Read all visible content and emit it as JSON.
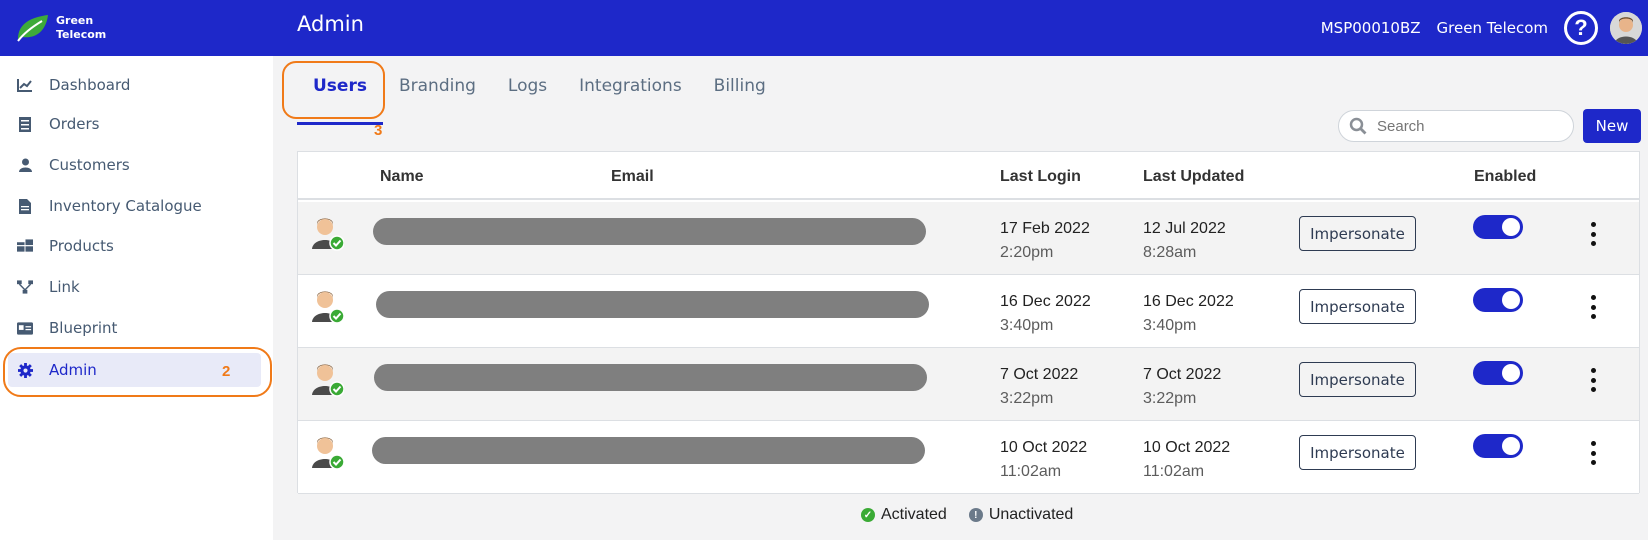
{
  "brand": {
    "name_line1": "Green",
    "name_line2": "Telecom",
    "color": "#3eaa3a"
  },
  "header": {
    "title": "Admin",
    "account_id": "MSP00010BZ",
    "account_name": "Green Telecom",
    "bg": "#1e28c9"
  },
  "sidebar": {
    "items": [
      {
        "label": "Dashboard",
        "icon": "chart-line-icon"
      },
      {
        "label": "Orders",
        "icon": "receipt-icon"
      },
      {
        "label": "Customers",
        "icon": "person-icon"
      },
      {
        "label": "Inventory Catalogue",
        "icon": "document-icon"
      },
      {
        "label": "Products",
        "icon": "boxes-icon"
      },
      {
        "label": "Link",
        "icon": "network-icon"
      },
      {
        "label": "Blueprint",
        "icon": "id-card-icon"
      },
      {
        "label": "Admin",
        "icon": "gear-icon",
        "active": true
      }
    ],
    "annotation": "2"
  },
  "tabs": {
    "items": [
      "Users",
      "Branding",
      "Logs",
      "Integrations",
      "Billing"
    ],
    "active": "Users",
    "annotation": "3"
  },
  "toolbar": {
    "search_placeholder": "Search",
    "new_label": "New"
  },
  "table": {
    "headers": {
      "name": "Name",
      "email": "Email",
      "last_login": "Last Login",
      "last_updated": "Last Updated",
      "enabled": "Enabled"
    },
    "rows": [
      {
        "login_date": "17 Feb 2022",
        "login_time": "2:20pm",
        "updated_date": "12 Jul 2022",
        "updated_time": "8:28am",
        "action": "Impersonate",
        "enabled": true
      },
      {
        "login_date": "16 Dec 2022",
        "login_time": "3:40pm",
        "updated_date": "16 Dec 2022",
        "updated_time": "3:40pm",
        "action": "Impersonate",
        "enabled": true
      },
      {
        "login_date": "7 Oct 2022",
        "login_time": "3:22pm",
        "updated_date": "7 Oct 2022",
        "updated_time": "3:22pm",
        "action": "Impersonate",
        "enabled": true
      },
      {
        "login_date": "10 Oct 2022",
        "login_time": "11:02am",
        "updated_date": "10 Oct 2022",
        "updated_time": "11:02am",
        "action": "Impersonate",
        "enabled": true
      }
    ]
  },
  "legend": {
    "activated": "Activated",
    "unactivated": "Unactivated",
    "activated_color": "#3aaa35",
    "unactivated_color": "#6b7a8a"
  }
}
